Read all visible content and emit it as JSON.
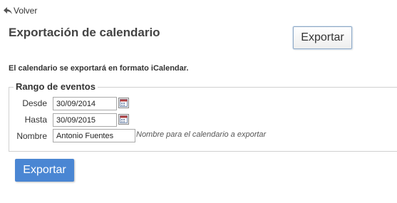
{
  "nav": {
    "back_label": "Volver"
  },
  "header": {
    "title": "Exportación de calendario",
    "export_label": "Exportar"
  },
  "info": {
    "text": "El calendario se exportará en formato iCalendar."
  },
  "range": {
    "legend": "Rango de eventos",
    "from_label": "Desde",
    "from_value": "30/09/2014",
    "to_label": "Hasta",
    "to_value": "30/09/2015",
    "name_label": "Nombre",
    "name_value": "Antonio Fuentes",
    "name_hint": "Nombre para el calendario a exportar"
  },
  "footer": {
    "export_label": "Exportar"
  },
  "icons": {
    "back": "arrow-back-icon",
    "calendar": "calendar-icon"
  },
  "colors": {
    "primary": "#4a86d3",
    "title": "#444444"
  }
}
